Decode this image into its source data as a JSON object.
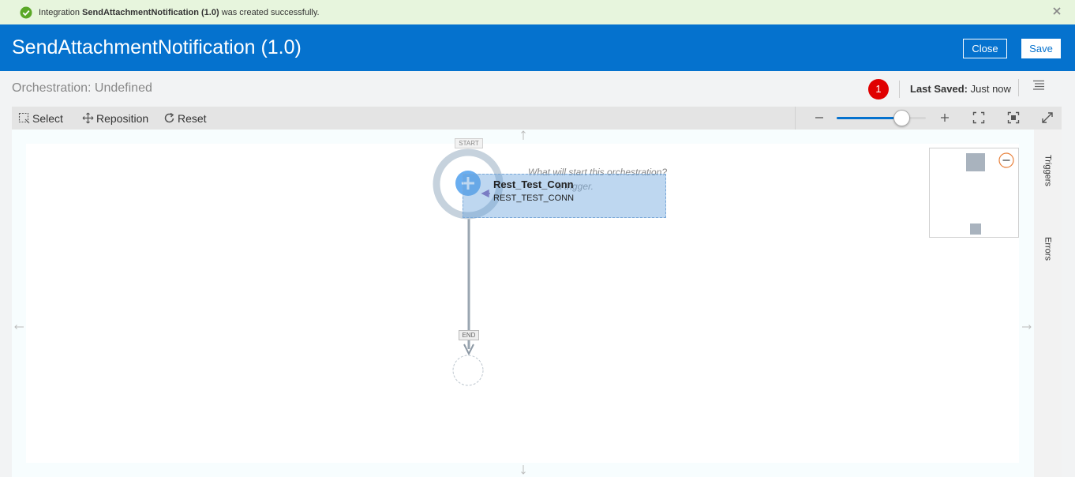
{
  "notification": {
    "prefix": "Integration",
    "name": "SendAttachmentNotification (1.0)",
    "suffix": "was created successfully.",
    "icon": "check-circle-icon",
    "close_icon": "close-icon"
  },
  "header": {
    "title": "SendAttachmentNotification (1.0)",
    "close_label": "Close",
    "save_label": "Save",
    "background": "#0572ce"
  },
  "subheader": {
    "orchestration": "Orchestration: Undefined",
    "error_count": "1",
    "last_saved_key": "Last Saved:",
    "last_saved_value": "Just now",
    "menu_icon": "menu-lines-icon"
  },
  "toolbar": {
    "select_label": "Select",
    "reposition_label": "Reposition",
    "reset_label": "Reset",
    "zoom_level": 0.73
  },
  "canvas": {
    "start_label": "START",
    "end_label": "END",
    "trigger_question": "What will start this orchestration?",
    "trigger_hint": "a trigger.",
    "node_name": "Rest_Test_Conn",
    "node_connection": "REST_TEST_CONN"
  },
  "side_tabs": {
    "triggers": "Triggers",
    "errors": "Errors"
  },
  "colors": {
    "success_bg": "#e7f5dd",
    "success_icon": "#5aa827",
    "badge": "#e00000",
    "accent": "#0572ce"
  }
}
